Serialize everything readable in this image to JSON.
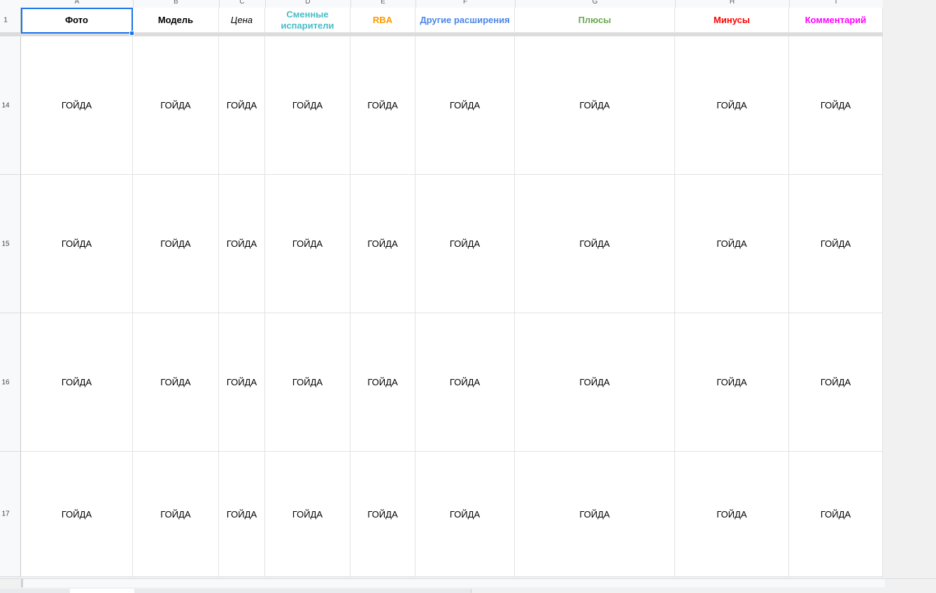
{
  "columns": [
    {
      "letter": "A"
    },
    {
      "letter": "B"
    },
    {
      "letter": "C"
    },
    {
      "letter": "D"
    },
    {
      "letter": "E"
    },
    {
      "letter": "F"
    },
    {
      "letter": "G"
    },
    {
      "letter": "H"
    },
    {
      "letter": "I"
    }
  ],
  "header_row": {
    "number": "1",
    "cells": [
      {
        "text": "Фото",
        "color": "#000000",
        "italic": false
      },
      {
        "text": "Модель",
        "color": "#000000",
        "italic": false
      },
      {
        "text": "Цена",
        "color": "#000000",
        "italic": true
      },
      {
        "text": "Сменные испарители",
        "color": "#46bdc6",
        "italic": false
      },
      {
        "text": "RBA",
        "color": "#ff9900",
        "italic": false
      },
      {
        "text": "Другие расширения",
        "color": "#4a86e8",
        "italic": false
      },
      {
        "text": "Плюсы",
        "color": "#6aa84f",
        "italic": false
      },
      {
        "text": "Минусы",
        "color": "#ff0000",
        "italic": false
      },
      {
        "text": "Комментарий",
        "color": "#ff00ff",
        "italic": false
      }
    ]
  },
  "rows": [
    {
      "number": "14",
      "cells": [
        "ГОЙДА",
        "ГОЙДА",
        "ГОЙДА",
        "ГОЙДА",
        "ГОЙДА",
        "ГОЙДА",
        "ГОЙДА",
        "ГОЙДА",
        "ГОЙДА"
      ]
    },
    {
      "number": "15",
      "cells": [
        "ГОЙДА",
        "ГОЙДА",
        "ГОЙДА",
        "ГОЙДА",
        "ГОЙДА",
        "ГОЙДА",
        "ГОЙДА",
        "ГОЙДА",
        "ГОЙДА"
      ]
    },
    {
      "number": "16",
      "cells": [
        "ГОЙДА",
        "ГОЙДА",
        "ГОЙДА",
        "ГОЙДА",
        "ГОЙДА",
        "ГОЙДА",
        "ГОЙДА",
        "ГОЙДА",
        "ГОЙДА"
      ]
    },
    {
      "number": "17",
      "cells": [
        "ГОЙДА",
        "ГОЙДА",
        "ГОЙДА",
        "ГОЙДА",
        "ГОЙДА",
        "ГОЙДА",
        "ГОЙДА",
        "ГОЙДА",
        "ГОЙДА"
      ]
    }
  ],
  "selected_cell": "A1",
  "colors": {
    "selection": "#1a73e8",
    "grid_line": "#e2e2e2"
  }
}
